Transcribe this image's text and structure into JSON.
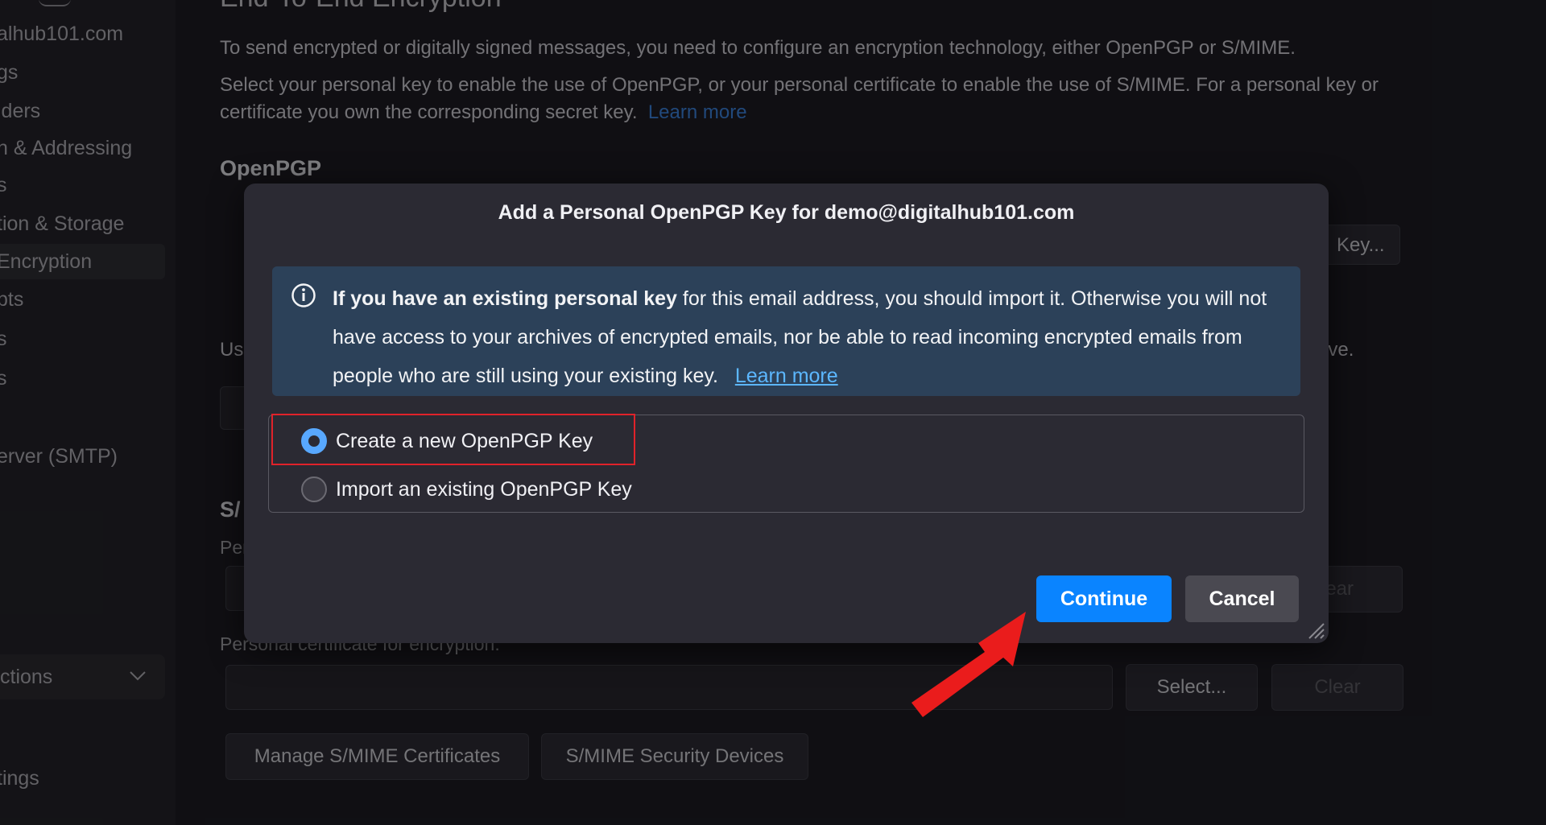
{
  "sidebar": {
    "items": [
      {
        "label": "alhub101.com"
      },
      {
        "label": "gs"
      },
      {
        "label": "lders"
      },
      {
        "label": "n & Addressing"
      },
      {
        "label": "s"
      },
      {
        "label": "tion & Storage"
      },
      {
        "label": "Encryption"
      },
      {
        "label": "pts"
      },
      {
        "label": "s"
      },
      {
        "label": "s"
      },
      {
        "label": "erver (SMTP)"
      }
    ],
    "actions_label": "ctions",
    "bottom_label": "tings"
  },
  "main": {
    "section_title": "End-To-End Encryption",
    "intro_1": "To send encrypted or digitally signed messages, you need to configure an encryption technology, either OpenPGP or S/MIME.",
    "intro_2": "Select your personal key to enable the use of OpenPGP, or your personal certificate to enable the use of S/MIME. For a personal key or certificate you own the corresponding secret key.",
    "intro_link": "Learn more",
    "openpgp_heading": "OpenPGP",
    "add_key_button": "Key...",
    "usage_text_start": "Us",
    "usage_text_end": "ove.",
    "smime_heading_cut": "S/",
    "personal_cut": "Per",
    "clear_1": "lear",
    "cert_encryption_label": "Personal certificate for encryption:",
    "select_button": "Select...",
    "clear_2": "Clear",
    "manage_certs_button": "Manage S/MIME Certificates",
    "security_devices_button": "S/MIME Security Devices"
  },
  "dialog": {
    "title": "Add a Personal OpenPGP Key for demo@digitalhub101.com",
    "info_bold": "If you have an existing personal key",
    "info_rest": " for this email address, you should import it. Otherwise you will not have access to your archives of encrypted emails, nor be able to read incoming encrypted emails from people who are still using your existing key.",
    "info_link": "Learn more",
    "options": [
      {
        "label": "Create a new OpenPGP Key",
        "selected": true
      },
      {
        "label": "Import an existing OpenPGP Key",
        "selected": false
      }
    ],
    "continue_label": "Continue",
    "cancel_label": "Cancel"
  },
  "colors": {
    "accent": "#0a84ff",
    "highlight": "#e0222a",
    "info_bg": "#2c4159"
  }
}
